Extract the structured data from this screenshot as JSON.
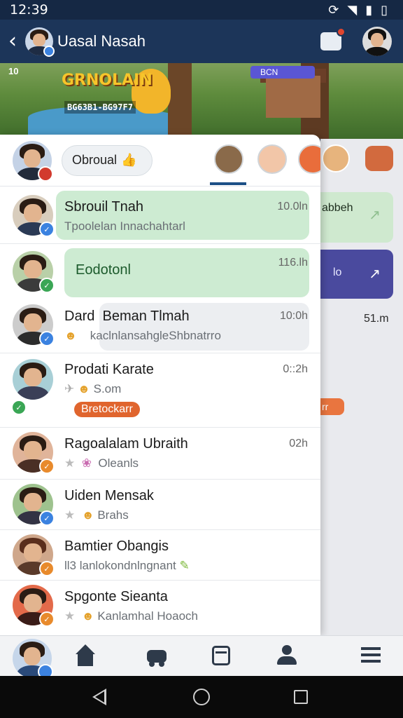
{
  "status_bar": {
    "time": "12:39",
    "icons": [
      "sync-icon",
      "wifi-icon",
      "signal-icon",
      "battery-icon"
    ]
  },
  "app_bar": {
    "title": "Uasal Nasah"
  },
  "banner": {
    "game_title": "GRNOLAIN",
    "game_subtitle": "BG63B1-BG97F7",
    "score": "10",
    "pill_label": "BCN"
  },
  "stories": {
    "chip_label": "Obroual",
    "chip_emoji": "👍"
  },
  "chats": [
    {
      "name": "Sbrouil Tnah",
      "message": "Tpoolelan Innachahtarl",
      "time": "10.0ln",
      "avatar_badge_color": "#3b82e0",
      "highlight": "green"
    },
    {
      "name": "",
      "message": "Eodotonl",
      "time": "116.lh",
      "avatar_badge_color": "#3aa655",
      "highlight": "green"
    },
    {
      "name": "Dard",
      "name2": "Beman Tlmah",
      "message": "kaclnlansahgleShbnatrro",
      "time": "10:0h",
      "avatar_badge_color": "#3b82e0",
      "highlight": "gray"
    },
    {
      "name": "Prodati Karate",
      "message": "S.om",
      "time": "0::2h",
      "avatar_badge_color": "#3aa655",
      "tag": "Bretockarr"
    },
    {
      "name": "Ragoalalam Ubraith",
      "message": "Oleanls",
      "time": "02h",
      "avatar_badge_color": "#e88a2c"
    },
    {
      "name": "Uiden Mensak",
      "message": "Brahs",
      "time": "",
      "avatar_badge_color": "#3b82e0"
    },
    {
      "name": "Bamtier Obangis",
      "message": "ll3  lanlokondnlngnant",
      "time": "",
      "avatar_badge_color": "#e88a2c"
    },
    {
      "name": "Spgonte Sieanta",
      "message": "Kanlamhal Hoaoch",
      "time": "",
      "avatar_badge_color": "#e88a2c"
    }
  ],
  "background_panel": {
    "row1_text": "abbeh",
    "row2_text": "lo",
    "time_text": "51.m"
  },
  "bottom_nav": [
    "home-icon",
    "car-icon",
    "bus-icon",
    "profile-icon",
    "menu-icon"
  ],
  "colors": {
    "app_bar": "#1c3559",
    "accent": "#1c4f86",
    "green_bubble": "#cdebd2",
    "tag": "#e0652e"
  }
}
